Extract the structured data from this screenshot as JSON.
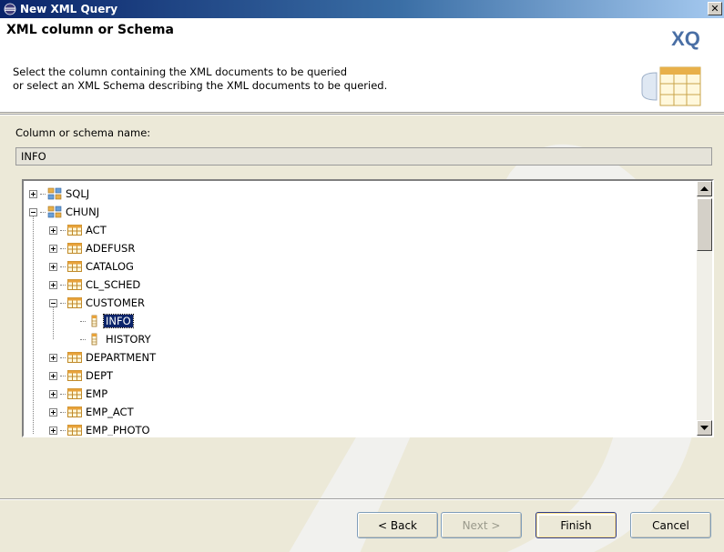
{
  "window": {
    "title": "New XML Query",
    "close_glyph": "✕"
  },
  "banner": {
    "title": "XML column or Schema",
    "description_line1": "Select the column containing the XML documents to be queried",
    "description_line2": "or select an XML Schema describing the XML documents to be queried.",
    "logo_text": "XQ"
  },
  "form": {
    "label": "Column or schema name:",
    "value": "INFO"
  },
  "tree": {
    "items": [
      {
        "label": "SQLJ",
        "icon": "schema-icon",
        "expander": "plus",
        "level": 0
      },
      {
        "label": "CHUNJ",
        "icon": "schema-icon",
        "expander": "minus",
        "level": 0
      },
      {
        "label": "ACT",
        "icon": "table-icon",
        "expander": "plus",
        "level": 1
      },
      {
        "label": "ADEFUSR",
        "icon": "table-icon",
        "expander": "plus",
        "level": 1
      },
      {
        "label": "CATALOG",
        "icon": "table-icon",
        "expander": "plus",
        "level": 1
      },
      {
        "label": "CL_SCHED",
        "icon": "table-icon",
        "expander": "plus",
        "level": 1
      },
      {
        "label": "CUSTOMER",
        "icon": "table-icon",
        "expander": "minus",
        "level": 1
      },
      {
        "label": "INFO",
        "icon": "column-icon",
        "expander": "none",
        "level": 2,
        "selected": true
      },
      {
        "label": "HISTORY",
        "icon": "column-icon",
        "expander": "none",
        "level": 2
      },
      {
        "label": "DEPARTMENT",
        "icon": "table-icon",
        "expander": "plus",
        "level": 1
      },
      {
        "label": "DEPT",
        "icon": "table-icon",
        "expander": "plus",
        "level": 1
      },
      {
        "label": "EMP",
        "icon": "table-icon",
        "expander": "plus",
        "level": 1
      },
      {
        "label": "EMP_ACT",
        "icon": "table-icon",
        "expander": "plus",
        "level": 1
      },
      {
        "label": "EMP_PHOTO",
        "icon": "table-icon",
        "expander": "plus",
        "level": 1
      }
    ]
  },
  "buttons": {
    "back": "< Back",
    "next": "Next >",
    "finish": "Finish",
    "cancel": "Cancel"
  },
  "colors": {
    "title_bar": "#0a246a",
    "selection": "#0a246a",
    "dialog_bg": "#ece9d8"
  }
}
